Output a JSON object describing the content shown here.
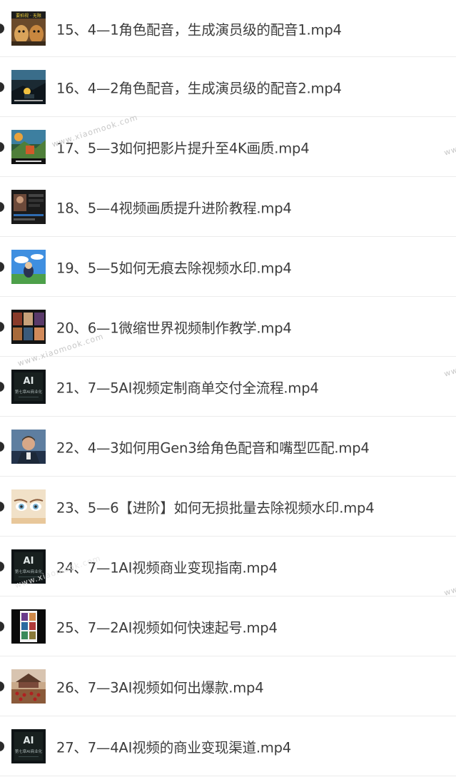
{
  "files": [
    {
      "label": "15、4—1角色配音，生成演员级的配音1.mp4",
      "thumb": "thumb-dogs-poster"
    },
    {
      "label": "16、4—2角色配音，生成演员级的配音2.mp4",
      "thumb": "thumb-night-scene"
    },
    {
      "label": "17、5—3如何把影片提升至4K画质.mp4",
      "thumb": "thumb-landscape-caption"
    },
    {
      "label": "18、5—4视频画质提升进阶教程.mp4",
      "thumb": "thumb-editor-dark"
    },
    {
      "label": "19、5—5如何无痕去除视频水印.mp4",
      "thumb": "thumb-blue-sky-character"
    },
    {
      "label": "20、6—1微缩世界视频制作教学.mp4",
      "thumb": "thumb-collage"
    },
    {
      "label": "21、7—5AI视频定制商单交付全流程.mp4",
      "thumb": "thumb-ai-slide"
    },
    {
      "label": "22、4—3如何用Gen3给角色配音和嘴型匹配.mp4",
      "thumb": "thumb-portrait-man"
    },
    {
      "label": "23、5—6【进阶】如何无损批量去除视频水印.mp4",
      "thumb": "thumb-anime-eyes"
    },
    {
      "label": "24、7—1AI视频商业变现指南.mp4",
      "thumb": "thumb-ai-slide"
    },
    {
      "label": "25、7—2AI视频如何快速起号.mp4",
      "thumb": "thumb-phone-feed"
    },
    {
      "label": "26、7—3AI视频如何出爆款.mp4",
      "thumb": "thumb-palace-army"
    },
    {
      "label": "27、7—4AI视频的商业变现渠道.mp4",
      "thumb": "thumb-ai-slide"
    }
  ],
  "thumb_text": {
    "dogs_banner": "要拍视 · 无限",
    "ai_slide_title": "AI",
    "ai_slide_subtitle": "第七章AI商业化"
  },
  "watermark": {
    "text": "www.xiaomook.com",
    "text_short": "ww"
  },
  "colors": {
    "text": "#3c3c3c",
    "divider": "#ececec",
    "watermark": "#c8c8c8"
  }
}
